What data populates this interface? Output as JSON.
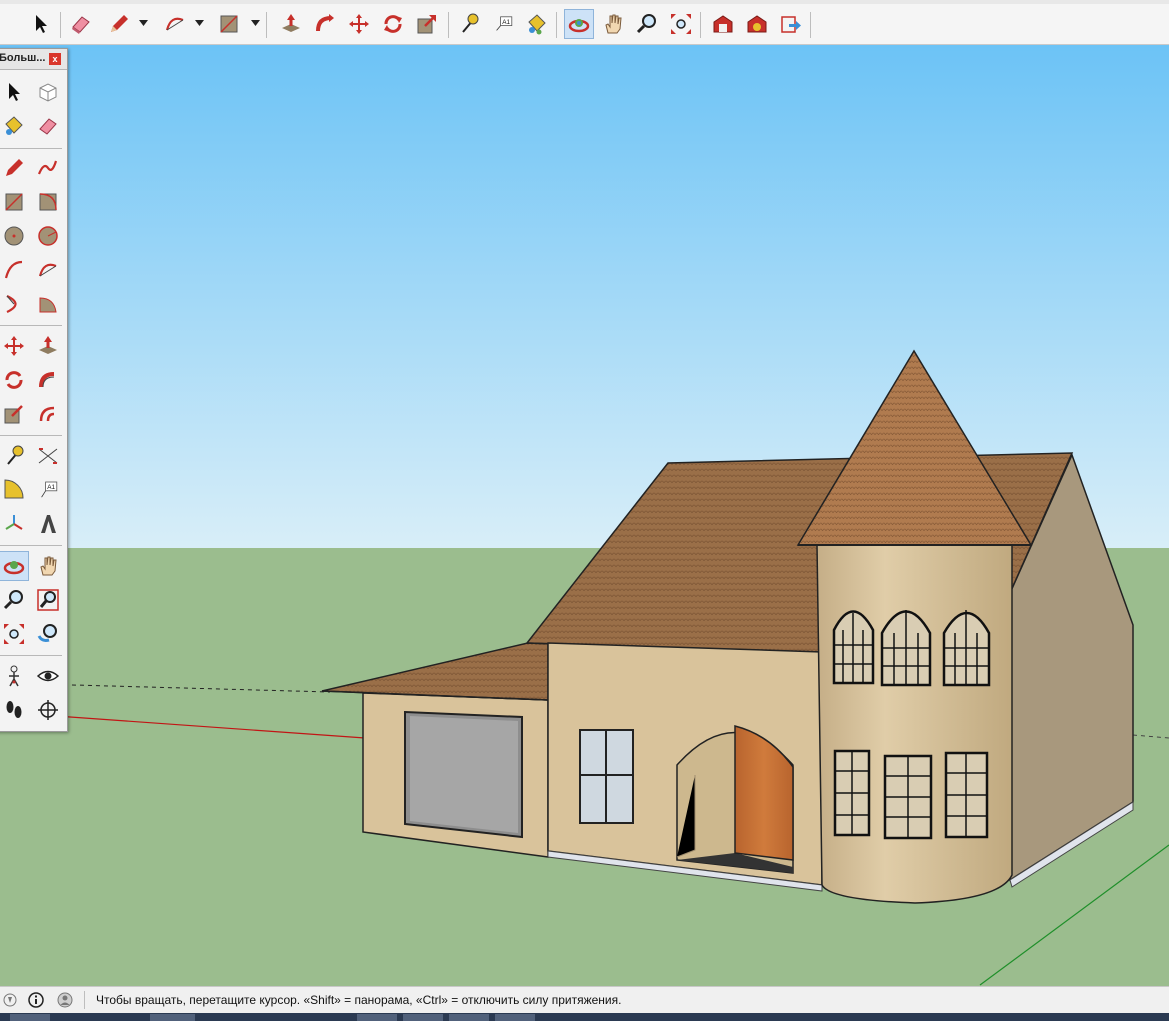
{
  "window": {
    "title_fragment": ""
  },
  "toolbar": {
    "items": [
      {
        "name": "select-icon",
        "tip": ""
      },
      {
        "name": "eraser-icon",
        "tip": ""
      },
      {
        "name": "pencil-icon",
        "tip": ""
      },
      {
        "name": "arc-icon",
        "tip": ""
      },
      {
        "name": "rectangle-icon",
        "tip": ""
      },
      {
        "name": "push-pull-icon",
        "tip": ""
      },
      {
        "name": "follow-me-icon",
        "tip": ""
      },
      {
        "name": "move-icon",
        "tip": ""
      },
      {
        "name": "rotate-icon",
        "tip": ""
      },
      {
        "name": "scale-icon",
        "tip": ""
      },
      {
        "name": "tape-measure-icon",
        "tip": ""
      },
      {
        "name": "text-icon",
        "tip": ""
      },
      {
        "name": "paint-bucket-icon",
        "tip": ""
      },
      {
        "name": "orbit-icon",
        "tip": ""
      },
      {
        "name": "pan-icon",
        "tip": ""
      },
      {
        "name": "zoom-icon",
        "tip": ""
      },
      {
        "name": "zoom-extents-icon",
        "tip": ""
      },
      {
        "name": "warehouse-icon",
        "tip": ""
      },
      {
        "name": "extension-warehouse-icon",
        "tip": ""
      },
      {
        "name": "share-model-icon",
        "tip": ""
      }
    ],
    "text_tool_label": "A1",
    "active_tool": "orbit"
  },
  "palette": {
    "title": "Больш...",
    "close_label": "x",
    "text_tool_label": "A1"
  },
  "status": {
    "message": "Чтобы вращать, перетащите курсор. «Shift» = панорама, «Ctrl» = отключить силу притяжения."
  },
  "colors": {
    "sky_top": "#6cc3f6",
    "sky_bottom": "#d8eef8",
    "ground": "#9bbd8e",
    "wall": "#d9c39b",
    "wall_shadow": "#a8987d",
    "roof": "#9a6f48",
    "door": "#c8743a",
    "accent_active": "#cde2f7"
  }
}
